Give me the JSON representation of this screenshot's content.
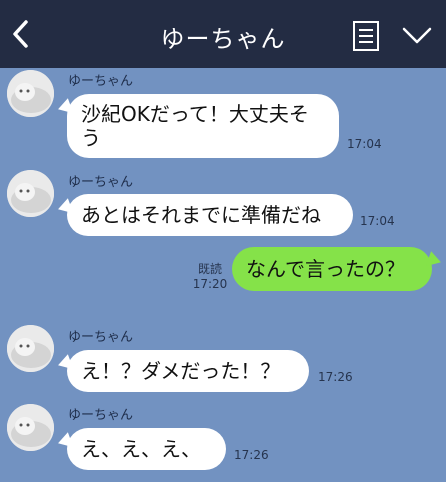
{
  "header": {
    "title": "ゆーちゃん",
    "back_icon": "chevron-left-icon",
    "menu_icon": "notes-icon",
    "collapse_icon": "chevron-down-icon"
  },
  "colors": {
    "header_bg": "#232c43",
    "chat_bg": "#7292c1",
    "bubble_in": "#ffffff",
    "bubble_out": "#85e249"
  },
  "messages": [
    {
      "sender": "ゆーちゃん",
      "text_line1": "沙紀OKだって！大丈夫そ",
      "text_line2": "う",
      "time": "17:04",
      "direction": "in"
    },
    {
      "sender": "ゆーちゃん",
      "text": "あとはそれまでに準備だね",
      "time": "17:04",
      "direction": "in"
    },
    {
      "read_label": "既読",
      "text": "なんで言ったの？",
      "time": "17:20",
      "direction": "out"
    },
    {
      "sender": "ゆーちゃん",
      "text": "え！？ダメだった！？",
      "time": "17:26",
      "direction": "in"
    },
    {
      "sender": "ゆーちゃん",
      "text": "え、え、え、",
      "time": "17:26",
      "direction": "in"
    }
  ]
}
